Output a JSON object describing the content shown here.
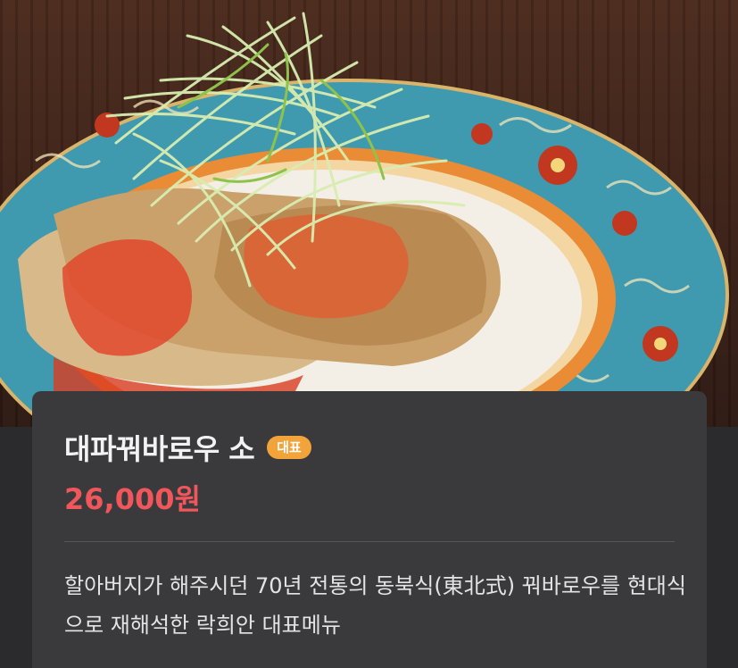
{
  "photo": {
    "alt": "대파꿔바로우 소",
    "plate_rim_color": "#3f9ab0",
    "plate_accent_color": "#e98c35",
    "sauce_color": "#e0482c",
    "scallion_color": "#d8edb0"
  },
  "menu": {
    "name": "대파꿔바로우 소",
    "badge": "대표",
    "price": "26,000원",
    "description": "할아버지가 해주시던 70년 전통의 동북식(東北式) 꿔바로우를 현대식으로 재해석한 락희안 대표메뉴"
  },
  "colors": {
    "background": "#2b2b2e",
    "card": "#3a3a3d",
    "title": "#f2f2f2",
    "badge": "#f2a33a",
    "price": "#f0565a",
    "description": "#e4e4e4"
  }
}
